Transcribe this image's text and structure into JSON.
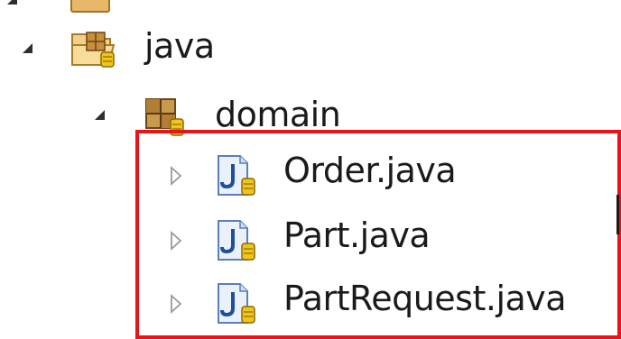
{
  "tree": {
    "source_folder": {
      "label": "java",
      "icon": "source-folder-icon",
      "expanded": true
    },
    "package": {
      "label": "domain",
      "icon": "package-icon",
      "expanded": true
    },
    "files": [
      {
        "label": "Order.java",
        "icon": "java-file-icon"
      },
      {
        "label": "Part.java",
        "icon": "java-file-icon"
      },
      {
        "label": "PartRequest.java",
        "icon": "java-file-icon"
      }
    ]
  },
  "colors": {
    "highlight_border": "#e8141c",
    "text": "#1a1a1a"
  }
}
